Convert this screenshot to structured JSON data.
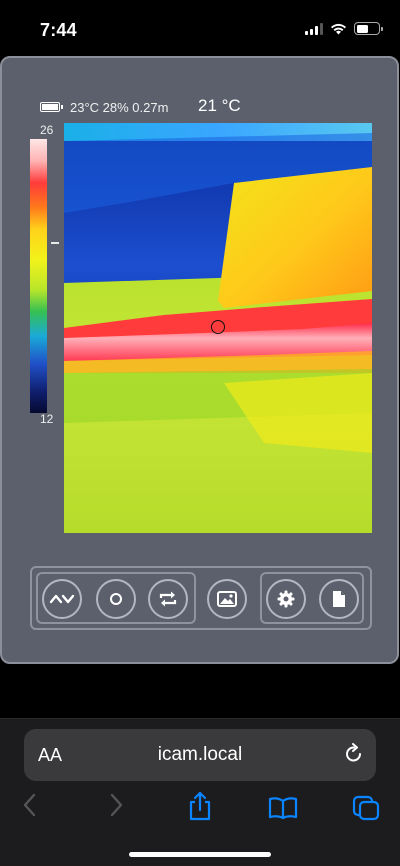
{
  "status": {
    "time": "7:44"
  },
  "header": {
    "info": "23°C 28% 0.27m",
    "center_temp": "21 °C"
  },
  "scale": {
    "max": "26",
    "min": "12"
  },
  "controls": {
    "buttons": [
      {
        "name": "adjust-range-button",
        "icon": "chevron-up-down-icon"
      },
      {
        "name": "capture-button",
        "icon": "circle-icon"
      },
      {
        "name": "rotate-button",
        "icon": "repeat-icon"
      },
      {
        "name": "gallery-button",
        "icon": "image-icon"
      },
      {
        "name": "settings-button",
        "icon": "gear-icon"
      },
      {
        "name": "file-button",
        "icon": "document-icon"
      }
    ]
  },
  "browser": {
    "aa_label": "AA",
    "url": "icam.local"
  },
  "colors": {
    "panel_bg": "#5b606c",
    "accent_blue": "#0a84ff"
  }
}
